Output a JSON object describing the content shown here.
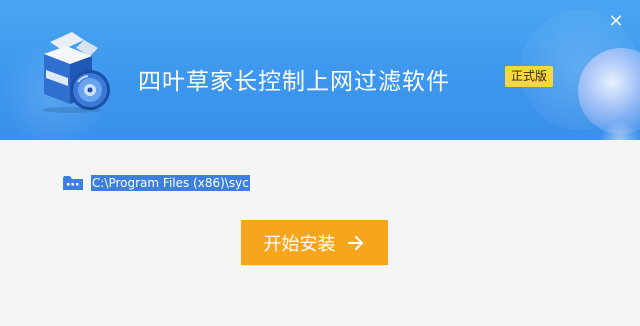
{
  "window": {
    "close_symbol": "✕",
    "colors": {
      "header_blue": "#3d97ee",
      "accent_orange": "#f7a51c",
      "badge_yellow": "#fad73f",
      "path_highlight": "#3d7fde"
    }
  },
  "header": {
    "title": "四叶草家长控制上网过滤软件",
    "edition_badge": "正式版",
    "product_icon": "software-box-with-cd-icon"
  },
  "install": {
    "folder_icon": "folder-icon",
    "path": "C:\\Program Files (x86)\\syc",
    "button_label": "开始安装",
    "button_icon": "arrow-right-icon"
  }
}
